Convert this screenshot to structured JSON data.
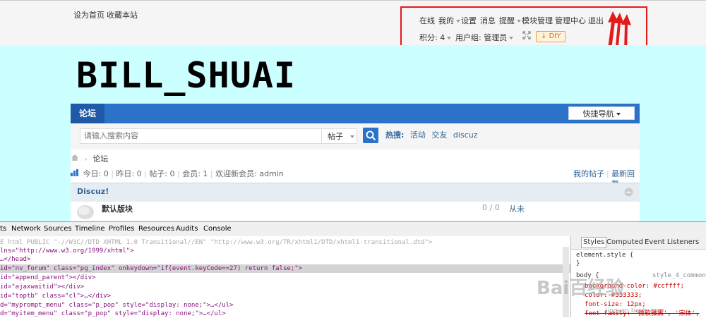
{
  "topbar": {
    "set_home": "设为首页",
    "bookmark": "收藏本站",
    "online": "在线",
    "mine": "我的",
    "settings": "设置",
    "messages": "消息",
    "reminders": "提醒",
    "module_mgmt": "模块管理",
    "admin_center": "管理中心",
    "logout": "退出",
    "points": "积分: 4",
    "usergroup": "用户组: 管理员",
    "diy": "DIY"
  },
  "header": {
    "logo": "BILL_SHUAI"
  },
  "nav": {
    "forum": "论坛",
    "quick_nav": "快捷导航"
  },
  "search": {
    "placeholder": "请输入搜索内容",
    "type": "帖子",
    "hot_label": "热搜:",
    "hot": [
      "活动",
      "交友",
      "discuz"
    ]
  },
  "breadcrumb": {
    "current": "论坛"
  },
  "stats": {
    "today": "今日: 0",
    "yesterday": "昨日: 0",
    "posts": "帖子: 0",
    "members": "会员: 1",
    "welcome": "欢迎新会员: admin",
    "my_posts": "我的帖子",
    "latest_replies": "最新回复"
  },
  "category": {
    "name": "Discuz!"
  },
  "forum_row": {
    "name": "默认版块",
    "counts": "0 / 0",
    "last_post": "从未"
  },
  "devtools": {
    "tabs": [
      "ts",
      "Network",
      "Sources",
      "Timeline",
      "Profiles",
      "Resources",
      "Audits",
      "Console"
    ],
    "source_lines": [
      {
        "tag": "E html PUBLIC \"-//W3C//DTD XHTML 1.0 Transitional//EN\" \"http://www.w3.org/TR/xhtml1/DTD/xhtml1-transitional.dtd\">",
        "gray": true
      },
      {
        "tag": "lns=\"http://www.w3.org/1999/xhtml\">"
      },
      {
        "tag": "…</head>"
      },
      {
        "tag": "id=\"nv_forum\" class=\"pg_index\" onkeydown=\"if(event.keyCode==27) return false;\">",
        "selected": true
      },
      {
        "tag": "id=\"append_parent\"></div>"
      },
      {
        "tag": "id=\"ajaxwaitid\"></div>"
      },
      {
        "tag": "id=\"toptb\" class=\"cl\">…</div>"
      },
      {
        "tag": "d=\"myprompt_menu\" class=\"p_pop\" style=\"display: none;\">…</ul>"
      },
      {
        "tag": "d=\"myitem_menu\" class=\"p_pop\" style=\"display: none;\">…</ul>"
      }
    ],
    "style_tabs": [
      "Styles",
      "Computed",
      "Event Listeners"
    ],
    "css_lines": [
      "element.style {",
      "}",
      "body {",
      "background-color: #ccffff;",
      "color: #333333;",
      "font-size: 12px;",
      "font-family: '微软雅黑', '宋体',"
    ],
    "css_source": "style_4_common"
  },
  "watermark": {
    "text": "Bai百经验",
    "url": "jingyan.baidu.com"
  },
  "colors": {
    "accent": "#2b72c9",
    "band": "#ccffff",
    "highlight": "#e31b1b"
  }
}
